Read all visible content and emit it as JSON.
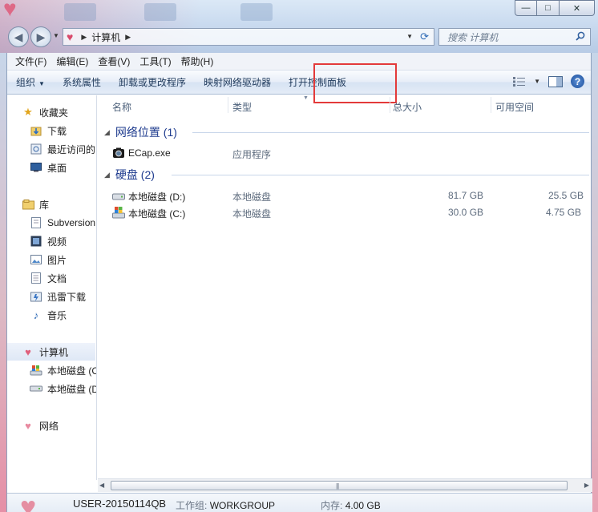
{
  "window": {
    "caption": {
      "minimize": "—",
      "maximize": "□",
      "close": "✕"
    }
  },
  "address_bar": {
    "location": "计算机",
    "search_placeholder": "搜索 计算机"
  },
  "menubar": [
    "文件(F)",
    "编辑(E)",
    "查看(V)",
    "工具(T)",
    "帮助(H)"
  ],
  "commandbar": {
    "organize": "组织",
    "system_properties": "系统属性",
    "uninstall": "卸载或更改程序",
    "map_drive": "映射网络驱动器",
    "open_control_panel": "打开控制面板",
    "help": "?"
  },
  "navigation": {
    "favorites": "收藏夹",
    "downloads": "下载",
    "recent": "最近访问的",
    "desktop": "桌面",
    "libraries": "库",
    "subversion": "Subversion",
    "videos": "视频",
    "pictures": "图片",
    "documents": "文档",
    "thunder": "迅雷下载",
    "music": "音乐",
    "computer": "计算机",
    "drive_c": "本地磁盘 (C",
    "drive_d": "本地磁盘 (D",
    "network": "网络"
  },
  "columns": {
    "name": "名称",
    "type": "类型",
    "total": "总大小",
    "free": "可用空间"
  },
  "groups": {
    "network_location": {
      "title": "网络位置 (1)"
    },
    "hard_disks": {
      "title": "硬盘 (2)"
    }
  },
  "items": {
    "ecap": {
      "name": "ECap.exe",
      "type": "应用程序"
    },
    "disk_d": {
      "name": "本地磁盘 (D:)",
      "type": "本地磁盘",
      "total": "81.7 GB",
      "free": "25.5 GB"
    },
    "disk_c": {
      "name": "本地磁盘 (C:)",
      "type": "本地磁盘",
      "total": "30.0 GB",
      "free": "4.75 GB"
    }
  },
  "details": {
    "computer_name": "USER-20150114QB",
    "workgroup_label": "工作组:",
    "workgroup": "WORKGROUP",
    "memory_label": "内存:",
    "memory": "4.00 GB"
  },
  "colors": {
    "highlight_box": "#e33a3a",
    "group_title": "#1e3b8e"
  }
}
